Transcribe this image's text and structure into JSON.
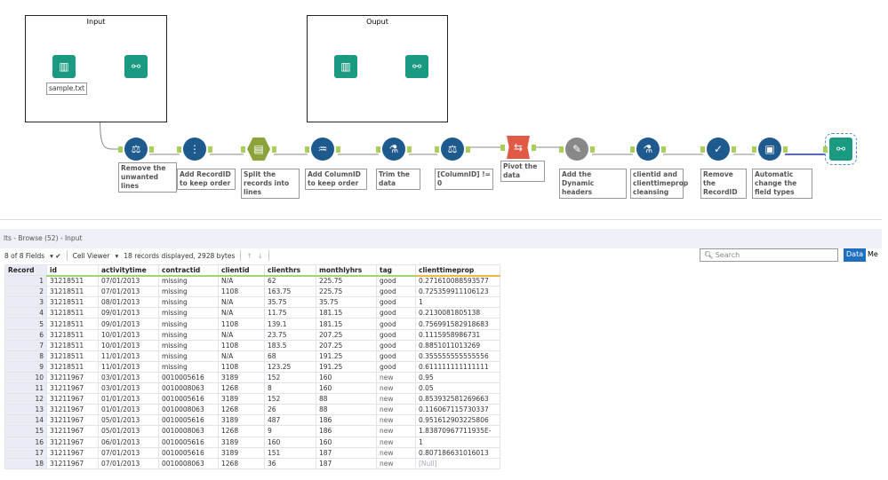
{
  "canvas": {
    "containers": [
      {
        "title": "Input"
      },
      {
        "title": "Ouput"
      }
    ],
    "input_file_label": "sample.txt",
    "tools": [
      {
        "label": "Remove the unwanted lines",
        "icon": "filter-icon"
      },
      {
        "label": "Add RecordID to keep order",
        "icon": "record-id-icon"
      },
      {
        "label": "Split the records into lines",
        "icon": "text-to-columns-icon"
      },
      {
        "label": "Add ColumnID to keep order",
        "icon": "multi-row-formula-icon"
      },
      {
        "label": "Trim the data",
        "icon": "formula-icon"
      },
      {
        "label": "[ColumnID] != 0",
        "icon": "filter-icon"
      },
      {
        "label": "Pivot the data",
        "icon": "cross-tab-icon"
      },
      {
        "label": "Add the Dynamic headers",
        "icon": "dynamic-rename-icon"
      },
      {
        "label": "clientid and clienttimeprop cleansing",
        "icon": "formula-icon"
      },
      {
        "label": "Remove the RecordID",
        "icon": "select-icon"
      },
      {
        "label": "Automatic change the field types",
        "icon": "auto-field-icon"
      },
      {
        "label": "",
        "icon": "browse-icon"
      }
    ]
  },
  "results": {
    "title": "lts - Browse (52) - Input",
    "fields": "8 of 8 Fields",
    "viewer": "Cell Viewer",
    "status": "18 records displayed, 2928 bytes",
    "search_placeholder": "Search",
    "data_btn": "Data",
    "meta_btn": "Me",
    "columns": [
      "Record",
      "id",
      "activitytime",
      "contractid",
      "clientid",
      "clienthrs",
      "monthlyhrs",
      "tag",
      "clienttimeprop"
    ],
    "rows": [
      [
        "1",
        "31218511",
        "07/01/2013",
        "missing",
        "N/A",
        "62",
        "225.75",
        "good",
        "0.271610088593577"
      ],
      [
        "2",
        "31218511",
        "07/01/2013",
        "missing",
        "1108",
        "163.75",
        "225.75",
        "good",
        "0.725359911106123"
      ],
      [
        "3",
        "31218511",
        "08/01/2013",
        "missing",
        "N/A",
        "35.75",
        "35.75",
        "good",
        "1"
      ],
      [
        "4",
        "31218511",
        "09/01/2013",
        "missing",
        "N/A",
        "11.75",
        "181.15",
        "good",
        "0.2130081805138"
      ],
      [
        "5",
        "31218511",
        "09/01/2013",
        "missing",
        "1108",
        "139.1",
        "181.15",
        "good",
        "0.756991582918683"
      ],
      [
        "6",
        "31218511",
        "10/01/2013",
        "missing",
        "N/A",
        "23.75",
        "207.25",
        "good",
        "0.1115958986731"
      ],
      [
        "7",
        "31218511",
        "10/01/2013",
        "missing",
        "1108",
        "183.5",
        "207.25",
        "good",
        "0.8851011013269"
      ],
      [
        "8",
        "31218511",
        "11/01/2013",
        "missing",
        "N/A",
        "68",
        "191.25",
        "good",
        "0.355555555555556"
      ],
      [
        "9",
        "31218511",
        "11/01/2013",
        "missing",
        "1108",
        "123.25",
        "191.25",
        "good",
        "0.611111111111111"
      ],
      [
        "10",
        "31211967",
        "03/01/2013",
        "0010005616",
        "3189",
        "152",
        "160",
        "new",
        "0.95"
      ],
      [
        "11",
        "31211967",
        "03/01/2013",
        "0010008063",
        "1268",
        "8",
        "160",
        "new",
        "0.05"
      ],
      [
        "12",
        "31211967",
        "01/01/2013",
        "0010005616",
        "3189",
        "152",
        "88",
        "new",
        "0.853932581269663"
      ],
      [
        "13",
        "31211967",
        "01/01/2013",
        "0010008063",
        "1268",
        "26",
        "88",
        "new",
        "0.116067115730337"
      ],
      [
        "14",
        "31211967",
        "05/01/2013",
        "0010005616",
        "3189",
        "487",
        "186",
        "new",
        "0.951612903225806"
      ],
      [
        "15",
        "31211967",
        "05/01/2013",
        "0010008063",
        "1268",
        "9",
        "186",
        "new",
        "1.83870967711935E-"
      ],
      [
        "16",
        "31211967",
        "06/01/2013",
        "0010005616",
        "3189",
        "160",
        "160",
        "new",
        "1"
      ],
      [
        "17",
        "31211967",
        "07/01/2013",
        "0010005616",
        "3189",
        "151",
        "187",
        "new",
        "0.807186631016013"
      ],
      [
        "18",
        "31211967",
        "07/01/2013",
        "0010008063",
        "1268",
        "36",
        "187",
        "new",
        "[Null]"
      ]
    ]
  }
}
